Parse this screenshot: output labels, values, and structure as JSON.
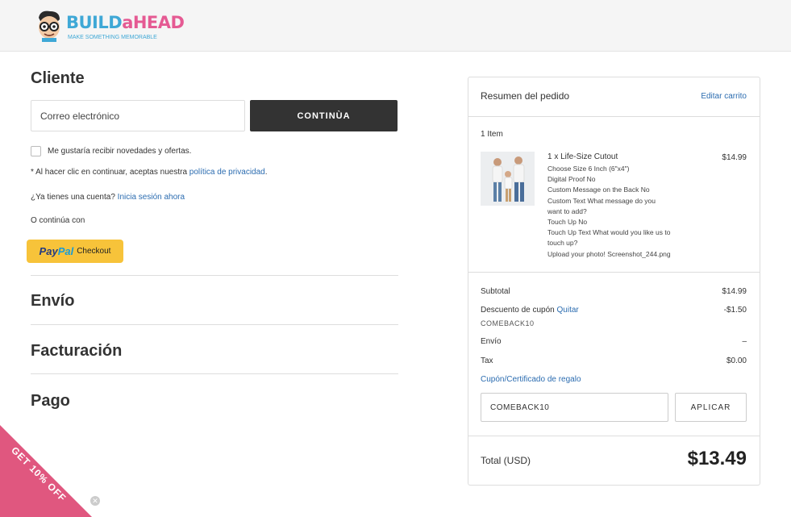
{
  "header": {
    "logo_word_1": "BUILD",
    "logo_word_2": "aHEAD",
    "logo_tagline": "MAKE SOMETHING MEMORABLE"
  },
  "customer": {
    "title": "Cliente",
    "email_placeholder": "Correo electrónico",
    "continue_label": "CONTINÙA",
    "newsletter_label": "Me gustaría recibir novedades y ofertas.",
    "privacy_prefix": "* Al hacer clic en continuar, aceptas nuestra",
    "privacy_link": "política de privacidad",
    "privacy_suffix": ".",
    "account_prefix": "¿Ya tienes una cuenta?",
    "account_link": "Inicia sesión ahora",
    "or_continue": "O continúa con",
    "paypal_pay": "Pay",
    "paypal_pal": "Pal",
    "paypal_checkout": "Checkout"
  },
  "sections": {
    "shipping": "Envío",
    "billing": "Facturación",
    "payment": "Pago"
  },
  "summary": {
    "title": "Resumen del pedido",
    "edit_cart": "Editar carrito",
    "item_count": "1 Item",
    "item": {
      "title": "1 x Life-Size Cutout",
      "price": "$14.99",
      "options": [
        "Choose Size 6 Inch (6\"x4\")",
        "Digital Proof No",
        "Custom Message on the Back No",
        "Custom Text What message do you",
        "want to add?",
        "Touch Up No",
        "Touch Up Text What would you like us to",
        "touch up?",
        "Upload your photo! Screenshot_244.png"
      ]
    },
    "subtotal_label": "Subtotal",
    "subtotal_value": "$14.99",
    "discount_label": "Descuento de cupón",
    "discount_remove": "Quitar",
    "discount_value": "-$1.50",
    "discount_code": "COMEBACK10",
    "shipping_label": "Envío",
    "shipping_value": "–",
    "tax_label": "Tax",
    "tax_value": "$0.00",
    "coupon_link": "Cupón/Certificado de regalo",
    "coupon_input_value": "COMEBACK10",
    "apply_label": "APLICAR",
    "total_label": "Total (USD)",
    "total_value": "$13.49"
  },
  "promo": {
    "label": "GET 10% OFF",
    "close_glyph": "✕"
  }
}
